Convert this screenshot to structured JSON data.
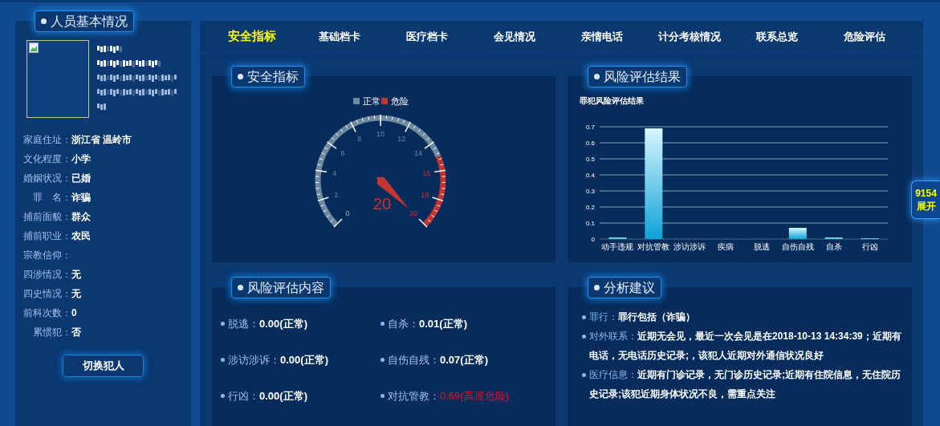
{
  "profile_panel": {
    "title": "人员基本情况",
    "fields": [
      {
        "label": "家庭住址：",
        "value": "浙江省 温岭市"
      },
      {
        "label": "文化程度：",
        "value": "小学"
      },
      {
        "label": "婚姻状况：",
        "value": "已婚"
      },
      {
        "label": "罪　名：",
        "value": "诈骗"
      },
      {
        "label": "捕前面貌：",
        "value": "群众"
      },
      {
        "label": "捕前职业：",
        "value": "农民"
      },
      {
        "label": "宗教信仰："
      },
      {
        "label": "四涉情况：",
        "value": "无"
      },
      {
        "label": "四史情况：",
        "value": "无"
      },
      {
        "label": "前科次数：",
        "value": "0"
      },
      {
        "label": "累惯犯：",
        "value": "否"
      }
    ],
    "button": "切换犯人"
  },
  "tabs": [
    {
      "label": "安全指标",
      "selected": true
    },
    {
      "label": "基础档卡",
      "selected": false
    },
    {
      "label": "医疗档卡",
      "selected": false
    },
    {
      "label": "会见情况",
      "selected": false
    },
    {
      "label": "亲情电话",
      "selected": false
    },
    {
      "label": "计分考核情况",
      "selected": false
    },
    {
      "label": "联系总览",
      "selected": false
    },
    {
      "label": "危险评估",
      "selected": false
    }
  ],
  "safety_card": {
    "title": "安全指标",
    "gauge": {
      "legend": [
        {
          "label": "正常",
          "color": "#6e8aa0"
        },
        {
          "label": "危险",
          "color": "#c23531"
        }
      ],
      "ticks": [
        "0",
        "2",
        "4",
        "6",
        "8",
        "10",
        "12",
        "14",
        "16",
        "18",
        "20"
      ],
      "value": "20"
    }
  },
  "risk_result_card": {
    "title": "风险评估结果",
    "chart_data": {
      "type": "bar",
      "title": "罪犯风险评估结果",
      "categories": [
        "动手违规",
        "对抗管教",
        "涉访涉诉",
        "疾病",
        "脱逃",
        "自伤自残",
        "自杀",
        "行凶"
      ],
      "values": [
        0.01,
        0.69,
        0,
        0,
        0,
        0.07,
        0.01,
        0.005
      ],
      "ylim": [
        0,
        0.7
      ],
      "grid": true,
      "yticks": [
        {
          "value": 0,
          "label": "0"
        },
        0.1,
        0.2,
        0.3,
        0.4,
        0.5,
        0.6,
        0.7
      ]
    }
  },
  "risk_content_card": {
    "title": "风险评估内容",
    "items": [
      {
        "label": "脱逃：",
        "value": "0.00(正常)",
        "danger": false
      },
      {
        "label": "自杀：",
        "value": "0.01(正常)",
        "danger": false
      },
      {
        "label": "涉访涉诉：",
        "value": "0.00(正常)",
        "danger": false
      },
      {
        "label": "自伤自残：",
        "value": "0.07(正常)",
        "danger": false
      },
      {
        "label": "行凶：",
        "value": "0.00(正常)",
        "danger": false
      },
      {
        "label": "对抗管教：",
        "value": "0.69(高度危险)",
        "danger": true
      }
    ]
  },
  "analysis_card": {
    "title": "分析建议",
    "items": [
      {
        "label": "罪行：",
        "text": "罪行包括（诈骗）"
      },
      {
        "label": "对外联系：",
        "text": "近期无会见，最近一次会见是在2018-10-13 14:34:39；近期有电话，无电话历史记录;，该犯人近期对外通信状况良好"
      },
      {
        "label": "医疗信息：",
        "text": "近期有门诊记录，无门诊历史记录;近期有住院信息，无住院历史记录;该犯近期身体状况不良，需重点关注"
      }
    ]
  },
  "side_tab": {
    "number": "9154",
    "label": "展开"
  }
}
